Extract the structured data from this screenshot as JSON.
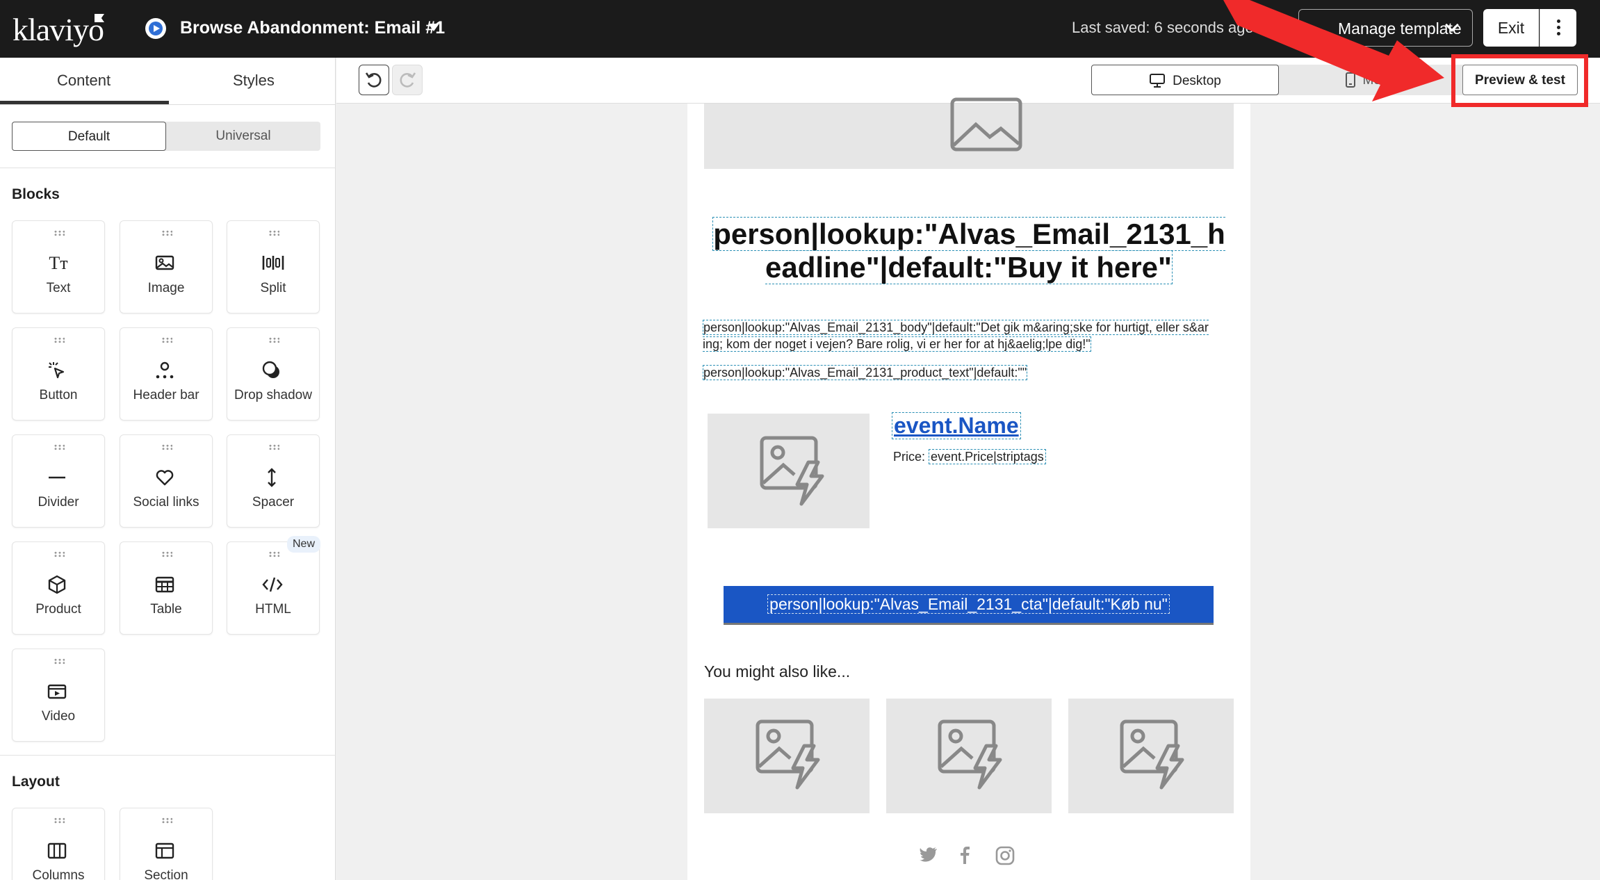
{
  "header": {
    "logo_text": "klaviyo",
    "flow_title": "Browse Abandonment: Email #1",
    "saved_status": "Last saved: 6 seconds ago",
    "manage_template_label": "Manage template",
    "exit_label": "Exit"
  },
  "sidebar": {
    "tabs": [
      {
        "label": "Content"
      },
      {
        "label": "Styles"
      }
    ],
    "segment": [
      {
        "label": "Default"
      },
      {
        "label": "Universal"
      }
    ],
    "blocks_title": "Blocks",
    "blocks": [
      {
        "label": "Text",
        "icon": "text-icon"
      },
      {
        "label": "Image",
        "icon": "image-icon"
      },
      {
        "label": "Split",
        "icon": "split-icon"
      },
      {
        "label": "Button",
        "icon": "cursor-click-icon"
      },
      {
        "label": "Header bar",
        "icon": "header-bar-icon"
      },
      {
        "label": "Drop shadow",
        "icon": "drop-shadow-icon"
      },
      {
        "label": "Divider",
        "icon": "divider-icon"
      },
      {
        "label": "Social links",
        "icon": "heart-icon"
      },
      {
        "label": "Spacer",
        "icon": "vertical-arrows-icon"
      },
      {
        "label": "Product",
        "icon": "cube-icon"
      },
      {
        "label": "Table",
        "icon": "table-icon"
      },
      {
        "label": "HTML",
        "icon": "code-icon"
      },
      {
        "label": "Video",
        "icon": "video-icon"
      }
    ],
    "new_badge": "New",
    "layout_title": "Layout",
    "layout_blocks": [
      {
        "label": "Columns",
        "icon": "columns-icon"
      },
      {
        "label": "Section",
        "icon": "section-icon"
      }
    ]
  },
  "toolbar": {
    "desktop_label": "Desktop",
    "mobile_label": "Mobile",
    "preview_label": "Preview & test"
  },
  "email": {
    "headline": "person|lookup:\"Alvas_Email_2131_headline\"|default:\"Buy it here\"",
    "body": "person|lookup:\"Alvas_Email_2131_body\"|default:\"Det gik m&aring;ske for hurtigt, eller s&aring; kom der noget i vejen? Bare rolig, vi er her for at hj&aelig;lpe dig!\"",
    "product_text": "person|lookup:\"Alvas_Email_2131_product_text\"|default:\"\"",
    "event_name": "event.Name",
    "price_label": "Price:",
    "price_value": "event.Price|striptags",
    "cta": "person|lookup:\"Alvas_Email_2131_cta\"|default:\"Køb nu\"",
    "recommend_title": "You might also like...",
    "social_icons": [
      "twitter-icon",
      "facebook-icon",
      "instagram-icon"
    ]
  },
  "colors": {
    "topbar": "#1b1b1b",
    "accent_blue": "#1a56c4",
    "highlight_red": "#f02a2a"
  }
}
